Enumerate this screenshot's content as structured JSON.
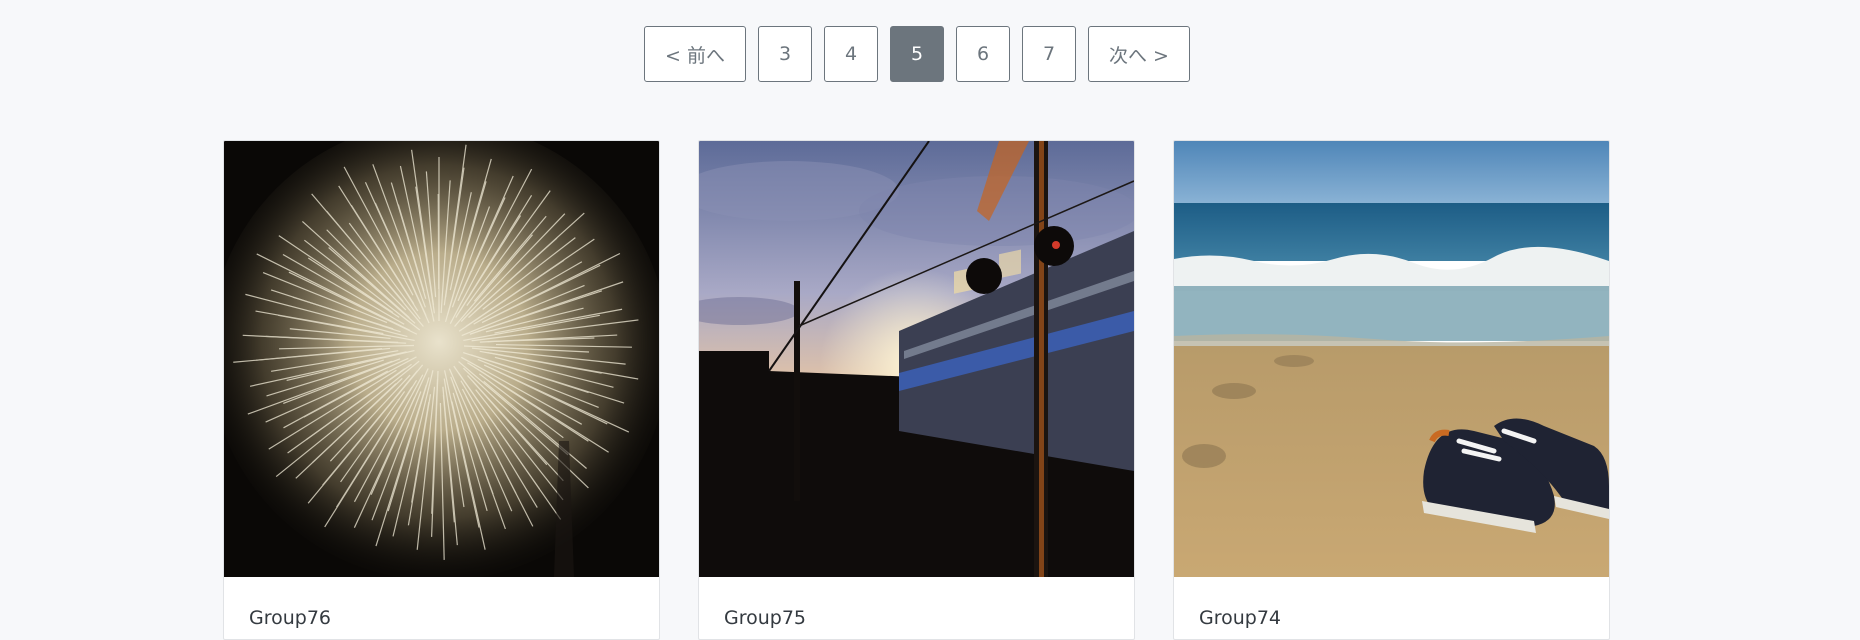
{
  "pagination": {
    "prev_label": "< 前へ",
    "next_label": "次へ >",
    "pages": [
      "3",
      "4",
      "5",
      "6",
      "7"
    ],
    "current_page": "5"
  },
  "cards": [
    {
      "title": "Group76",
      "image": "fireworks-photo"
    },
    {
      "title": "Group75",
      "image": "train-sunset-photo"
    },
    {
      "title": "Group74",
      "image": "beach-sneakers-photo"
    }
  ],
  "colors": {
    "page_background": "#f7f8fa",
    "button_border": "#6c757d",
    "active_button": "#6c757d"
  }
}
